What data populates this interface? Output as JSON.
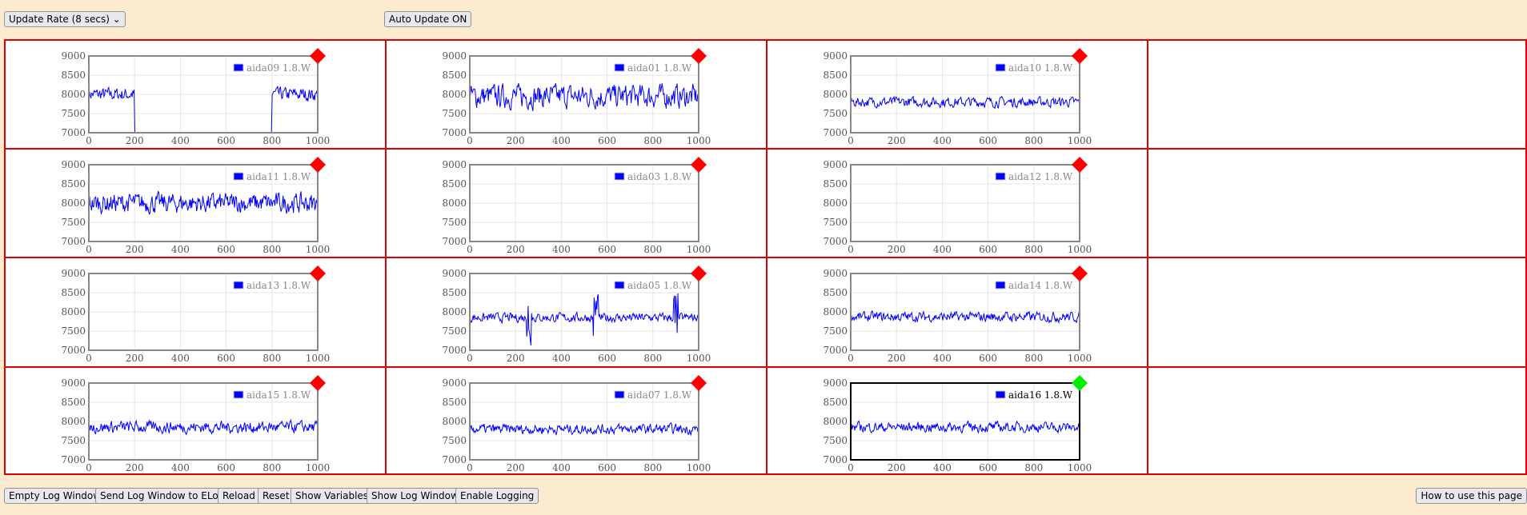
{
  "toolbar": {
    "update_rate": "Update Rate (8 secs)",
    "auto_update": "Auto Update ON"
  },
  "footer": {
    "empty_log": "Empty Log Window",
    "send_log": "Send Log Window to ELog",
    "reload": "Reload",
    "reset": "Reset",
    "show_variables": "Show Variables",
    "show_log": "Show Log Window",
    "enable_logging": "Enable Logging",
    "how_to": "How to use this page"
  },
  "colors": {
    "alarm": "#ff0000",
    "ok": "#00ee00",
    "series": "#0000ff",
    "border": "#dd0000"
  },
  "chart_data": [
    {
      "type": "line",
      "legend": "aida09 1.8.W",
      "status": "alarm",
      "mean": 8000,
      "amp": 150,
      "gap": [
        200,
        800
      ],
      "xlim": [
        0,
        1000
      ],
      "ylim": [
        7000,
        9000
      ],
      "xticks": [
        "0",
        "200",
        "400",
        "600",
        "800",
        "1000"
      ],
      "yticks": [
        "9000",
        "8500",
        "8000",
        "7500",
        "7000"
      ]
    },
    {
      "type": "line",
      "legend": "aida01 1.8.W",
      "status": "alarm",
      "mean": 7950,
      "amp": 260,
      "xlim": [
        0,
        1000
      ],
      "ylim": [
        7000,
        9000
      ],
      "xticks": [
        "0",
        "200",
        "400",
        "600",
        "800",
        "1000"
      ],
      "yticks": [
        "9000",
        "8500",
        "8000",
        "7500",
        "7000"
      ]
    },
    {
      "type": "line",
      "legend": "aida10 1.8.W",
      "status": "alarm",
      "mean": 7800,
      "amp": 110,
      "xlim": [
        0,
        1000
      ],
      "ylim": [
        7000,
        9000
      ],
      "xticks": [
        "0",
        "200",
        "400",
        "600",
        "800",
        "1000"
      ],
      "yticks": [
        "9000",
        "8500",
        "8000",
        "7500",
        "7000"
      ]
    },
    {
      "type": "line",
      "legend": "aida11 1.8.W",
      "status": "alarm",
      "mean": 8000,
      "amp": 220,
      "xlim": [
        0,
        1000
      ],
      "ylim": [
        7000,
        9000
      ],
      "xticks": [
        "0",
        "200",
        "400",
        "600",
        "800",
        "1000"
      ],
      "yticks": [
        "9000",
        "8500",
        "8000",
        "7500",
        "7000"
      ]
    },
    {
      "type": "line",
      "legend": "aida03 1.8.W",
      "status": "alarm",
      "empty": true,
      "xlim": [
        0,
        1000
      ],
      "ylim": [
        7000,
        9000
      ],
      "xticks": [
        "0",
        "200",
        "400",
        "600",
        "800",
        "1000"
      ],
      "yticks": [
        "9000",
        "8500",
        "8000",
        "7500",
        "7000"
      ]
    },
    {
      "type": "line",
      "legend": "aida12 1.8.W",
      "status": "alarm",
      "empty": true,
      "xlim": [
        0,
        1000
      ],
      "ylim": [
        7000,
        9000
      ],
      "xticks": [
        "0",
        "200",
        "400",
        "600",
        "800",
        "1000"
      ],
      "yticks": [
        "9000",
        "8500",
        "8000",
        "7500",
        "7000"
      ]
    },
    {
      "type": "line",
      "legend": "aida13 1.8.W",
      "status": "alarm",
      "empty": true,
      "xlim": [
        0,
        1000
      ],
      "ylim": [
        7000,
        9000
      ],
      "xticks": [
        "0",
        "200",
        "400",
        "600",
        "800",
        "1000"
      ],
      "yticks": [
        "9000",
        "8500",
        "8000",
        "7500",
        "7000"
      ]
    },
    {
      "type": "line",
      "legend": "aida05 1.8.W",
      "status": "alarm",
      "mean": 7850,
      "amp": 100,
      "spikes": [
        260,
        550,
        900
      ],
      "xlim": [
        0,
        1000
      ],
      "ylim": [
        7000,
        9000
      ],
      "xticks": [
        "0",
        "200",
        "400",
        "600",
        "800",
        "1000"
      ],
      "yticks": [
        "9000",
        "8500",
        "8000",
        "7500",
        "7000"
      ]
    },
    {
      "type": "line",
      "legend": "aida14 1.8.W",
      "status": "alarm",
      "mean": 7870,
      "amp": 110,
      "xlim": [
        0,
        1000
      ],
      "ylim": [
        7000,
        9000
      ],
      "xticks": [
        "0",
        "200",
        "400",
        "600",
        "800",
        "1000"
      ],
      "yticks": [
        "9000",
        "8500",
        "8000",
        "7500",
        "7000"
      ]
    },
    {
      "type": "line",
      "legend": "aida15 1.8.W",
      "status": "alarm",
      "mean": 7850,
      "amp": 130,
      "xlim": [
        0,
        1000
      ],
      "ylim": [
        7000,
        9000
      ],
      "xticks": [
        "0",
        "200",
        "400",
        "600",
        "800",
        "1000"
      ],
      "yticks": [
        "9000",
        "8500",
        "8000",
        "7500",
        "7000"
      ]
    },
    {
      "type": "line",
      "legend": "aida07 1.8.W",
      "status": "alarm",
      "mean": 7800,
      "amp": 110,
      "xlim": [
        0,
        1000
      ],
      "ylim": [
        7000,
        9000
      ],
      "xticks": [
        "0",
        "200",
        "400",
        "600",
        "800",
        "1000"
      ],
      "yticks": [
        "9000",
        "8500",
        "8000",
        "7500",
        "7000"
      ]
    },
    {
      "type": "line",
      "legend": "aida16 1.8.W",
      "status": "ok",
      "selected": true,
      "mean": 7850,
      "amp": 110,
      "xlim": [
        0,
        1000
      ],
      "ylim": [
        7000,
        9000
      ],
      "xticks": [
        "0",
        "200",
        "400",
        "600",
        "800",
        "1000"
      ],
      "yticks": [
        "9000",
        "8500",
        "8000",
        "7500",
        "7000"
      ]
    }
  ]
}
